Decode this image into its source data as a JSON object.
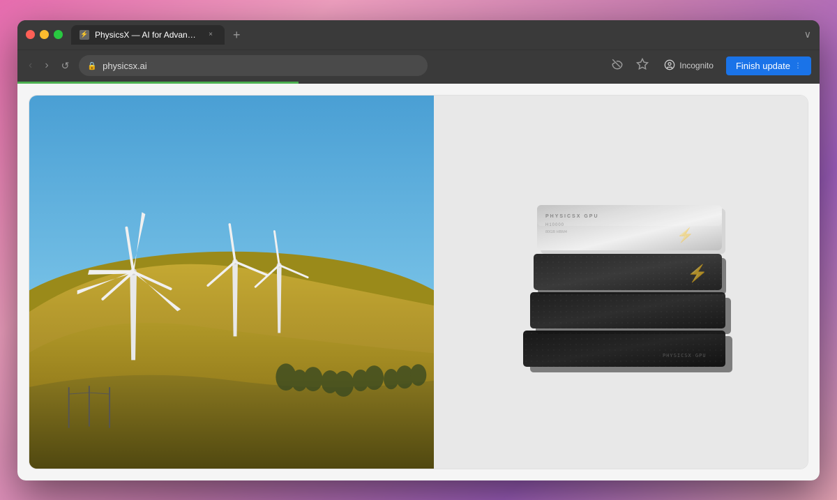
{
  "browser": {
    "tab": {
      "favicon": "⚡",
      "title": "PhysicsX — AI for Advanced...",
      "close_label": "×"
    },
    "new_tab_label": "+",
    "window_chevron": "∨"
  },
  "toolbar": {
    "back_label": "‹",
    "forward_label": "›",
    "reload_label": "↺",
    "address": "physicsx.ai",
    "address_icon": "🔒",
    "toolbar_icon_1": "👁",
    "toolbar_icon_2": "★",
    "incognito_label": "Incognito",
    "incognito_icon": "🕵",
    "finish_update_label": "Finish update",
    "finish_update_chevron": "⋮",
    "progress_width": "35%"
  },
  "content": {
    "left_panel": {
      "alt": "Wind turbines on rolling hills under blue sky"
    },
    "right_panel": {
      "alt": "PhysicsX GPU chip stack illustration",
      "gpu_text": "PHYSICSX GPU",
      "chip_label": "PHYSICSX GPU"
    }
  }
}
